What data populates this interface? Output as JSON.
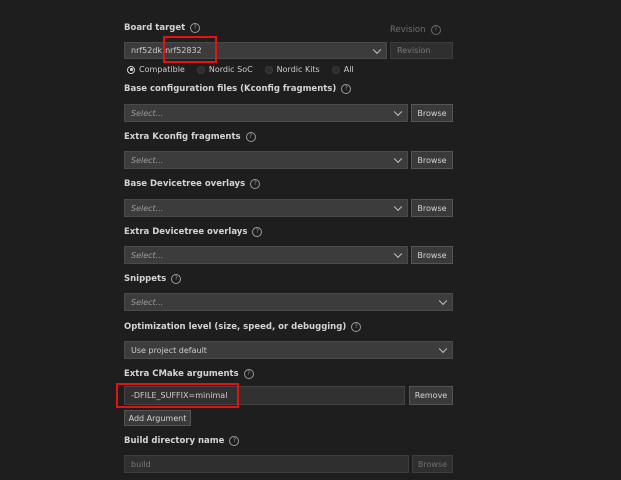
{
  "board_target": {
    "label": "Board target",
    "value_prefix": "nrf52dk",
    "value_suffix": "nrf52832",
    "radios": [
      {
        "label": "Compatible",
        "selected": true
      },
      {
        "label": "Nordic SoC",
        "selected": false
      },
      {
        "label": "Nordic Kits",
        "selected": false
      },
      {
        "label": "All",
        "selected": false
      }
    ]
  },
  "revision": {
    "label": "Revision",
    "placeholder": "Revision"
  },
  "base_config": {
    "label": "Base configuration files (Kconfig fragments)",
    "placeholder": "Select...",
    "button": "Browse"
  },
  "extra_kconfig": {
    "label": "Extra Kconfig fragments",
    "placeholder": "Select...",
    "button": "Browse"
  },
  "base_dt": {
    "label": "Base Devicetree overlays",
    "placeholder": "Select...",
    "button": "Browse"
  },
  "extra_dt": {
    "label": "Extra Devicetree overlays",
    "placeholder": "Select...",
    "button": "Browse"
  },
  "snippets": {
    "label": "Snippets",
    "placeholder": "Select..."
  },
  "optimization": {
    "label": "Optimization level (size, speed, or debugging)",
    "value": "Use project default"
  },
  "cmake": {
    "label": "Extra CMake arguments",
    "value": "-DFILE_SUFFIX=minimal",
    "remove_button": "Remove",
    "add_button": "Add Argument"
  },
  "build_dir": {
    "label": "Build directory name",
    "placeholder": "build",
    "button": "Browse"
  },
  "icons": {
    "help": "help-circle-icon",
    "dropdown": "chevron-down-icon"
  },
  "colors": {
    "background": "#1e1e1e",
    "highlight": "#e41212"
  }
}
